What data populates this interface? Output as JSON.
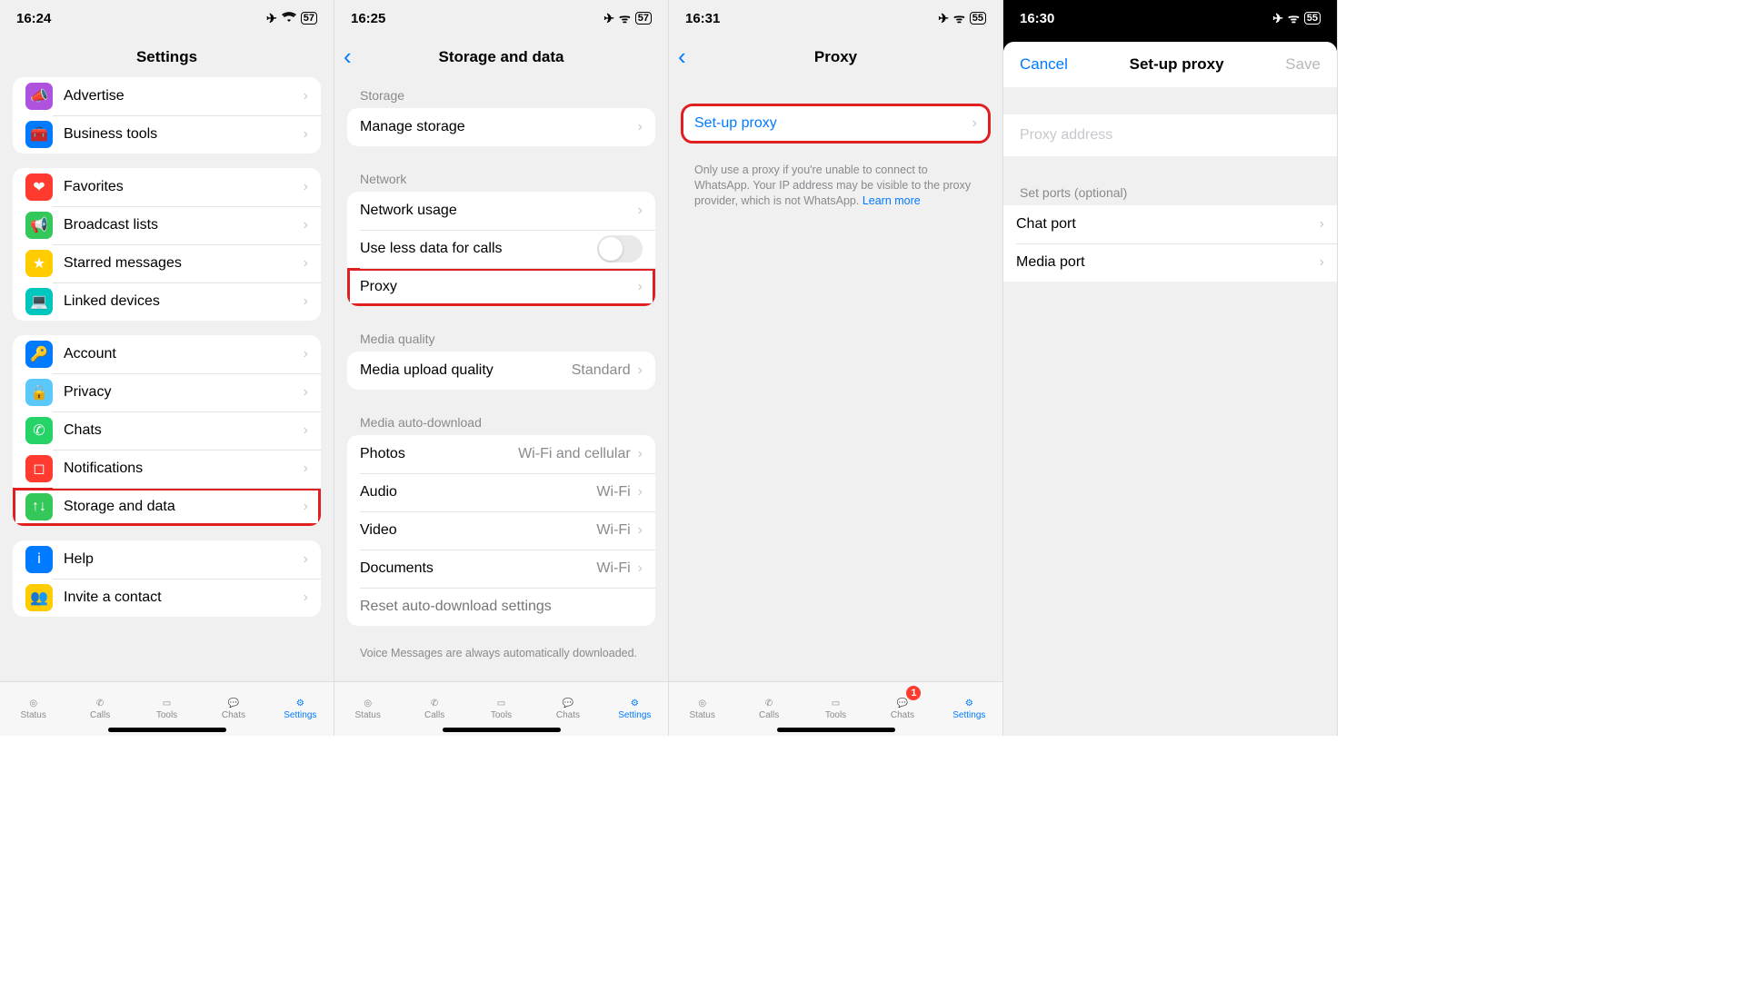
{
  "status": {
    "times": [
      "16:24",
      "16:25",
      "16:31",
      "16:30"
    ],
    "battery": [
      "57",
      "57",
      "55",
      "55"
    ]
  },
  "screen1": {
    "title": "Settings",
    "group1": [
      {
        "icon": "megaphone",
        "bg": "#af52de",
        "label": "Advertise"
      },
      {
        "icon": "briefcase",
        "bg": "#007aff",
        "label": "Business tools"
      }
    ],
    "group2": [
      {
        "icon": "heart",
        "bg": "#ff3b30",
        "label": "Favorites"
      },
      {
        "icon": "broadcast",
        "bg": "#34c759",
        "label": "Broadcast lists"
      },
      {
        "icon": "star",
        "bg": "#ffcc00",
        "label": "Starred messages"
      },
      {
        "icon": "devices",
        "bg": "#00c7be",
        "label": "Linked devices"
      }
    ],
    "group3": [
      {
        "icon": "key",
        "bg": "#007aff",
        "label": "Account"
      },
      {
        "icon": "lock",
        "bg": "#5ac8fa",
        "label": "Privacy"
      },
      {
        "icon": "whatsapp",
        "bg": "#25d366",
        "label": "Chats"
      },
      {
        "icon": "bell",
        "bg": "#ff3b30",
        "label": "Notifications"
      },
      {
        "icon": "arrows",
        "bg": "#34c759",
        "label": "Storage and data",
        "hl": true
      }
    ],
    "group4": [
      {
        "icon": "info",
        "bg": "#007aff",
        "label": "Help"
      },
      {
        "icon": "people",
        "bg": "#ffcc00",
        "label": "Invite a contact"
      }
    ]
  },
  "screen2": {
    "title": "Storage and data",
    "storage_header": "Storage",
    "manage": "Manage storage",
    "network_header": "Network",
    "network_usage": "Network usage",
    "use_less": "Use less data for calls",
    "proxy": "Proxy",
    "media_q_header": "Media quality",
    "media_upload": "Media upload quality",
    "media_upload_val": "Standard",
    "autodl_header": "Media auto-download",
    "photos": "Photos",
    "photos_v": "Wi-Fi and cellular",
    "audio": "Audio",
    "audio_v": "Wi-Fi",
    "video": "Video",
    "video_v": "Wi-Fi",
    "documents": "Documents",
    "documents_v": "Wi-Fi",
    "reset": "Reset auto-download settings",
    "voice_note": "Voice Messages are always automatically downloaded."
  },
  "screen3": {
    "title": "Proxy",
    "setup": "Set-up proxy",
    "note": "Only use a proxy if you're unable to connect to WhatsApp. Your IP address may be visible to the proxy provider, which is not WhatsApp. ",
    "learn": "Learn more"
  },
  "screen4": {
    "cancel": "Cancel",
    "title": "Set-up proxy",
    "save": "Save",
    "placeholder": "Proxy address",
    "ports_header": "Set ports (optional)",
    "chat_port": "Chat port",
    "media_port": "Media port"
  },
  "tabs": {
    "items": [
      "Status",
      "Calls",
      "Tools",
      "Chats",
      "Settings"
    ],
    "badge": "1"
  }
}
